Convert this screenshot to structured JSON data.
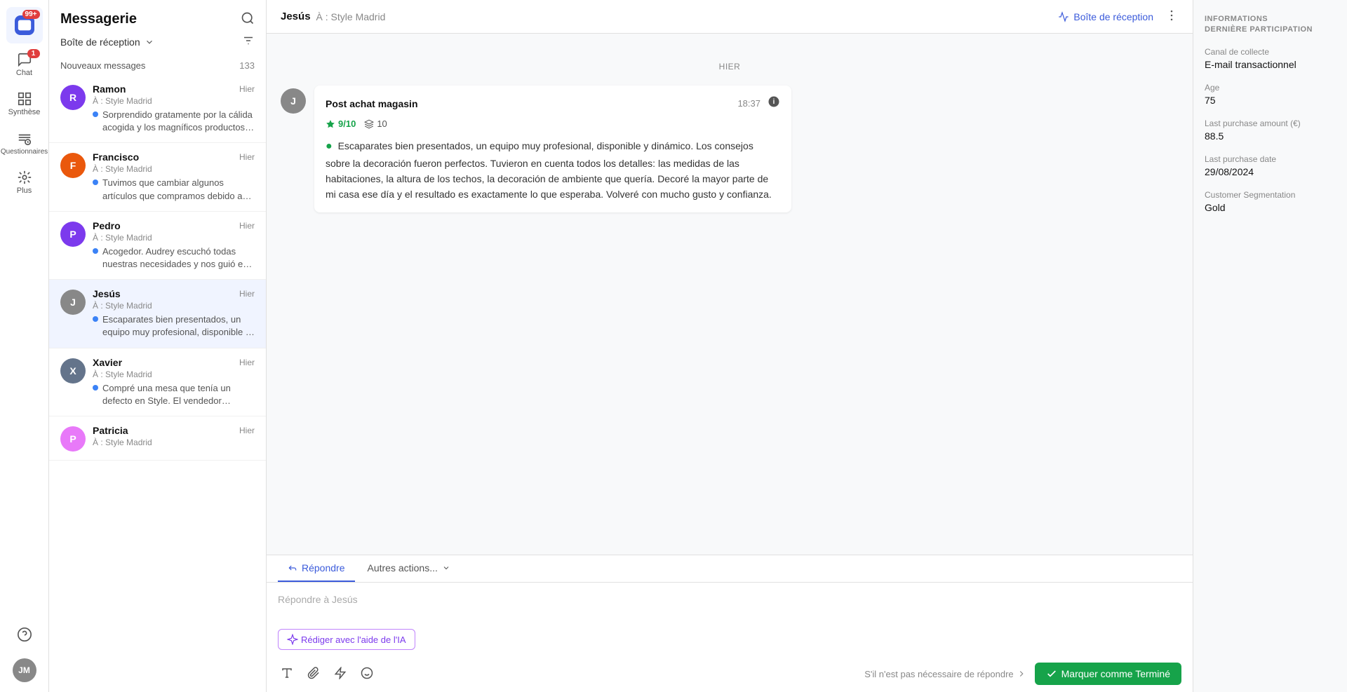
{
  "iconBar": {
    "messagerie": "Messagerie",
    "chat": "Chat",
    "synthese": "Synthèse",
    "questionnaires": "Questionnaires",
    "plus": "Plus",
    "badge99": "99+",
    "badge1": "1",
    "userInitials": "JM"
  },
  "sidebar": {
    "title": "Messagerie",
    "inboxLabel": "Boîte de réception",
    "newMessages": "Nouveaux messages",
    "newCount": "133",
    "messages": [
      {
        "initial": "R",
        "name": "Ramon",
        "destination": "À : Style Madrid",
        "time": "Hier",
        "preview": "Sorprendido gratamente por la cálida acogida y los magníficos productos. Amplia...",
        "color": "#7c3aed"
      },
      {
        "initial": "F",
        "name": "Francisco",
        "destination": "À : Style Madrid",
        "time": "Hier",
        "preview": "Tuvimos que cambiar algunos artículos que compramos debido a que el color no er...",
        "color": "#ea580c"
      },
      {
        "initial": "P",
        "name": "Pedro",
        "destination": "À : Style Madrid",
        "time": "Hier",
        "preview": "Acogedor. Audrey escuchó todas nuestras necesidades y nos guió en nuestra...",
        "color": "#7c3aed"
      },
      {
        "initial": "J",
        "name": "Jesús",
        "destination": "À : Style Madrid",
        "time": "Hier",
        "preview": "Escaparates bien presentados, un equipo muy profesional, disponible y dinámico. Los...",
        "color": "#888",
        "active": true
      },
      {
        "initial": "X",
        "name": "Xavier",
        "destination": "À : Style Madrid",
        "time": "Hier",
        "preview": "Compré una mesa que tenía un defecto en Style. El vendedor accedió a cerrar la...",
        "color": "#64748b"
      },
      {
        "initial": "P",
        "name": "Patricia",
        "destination": "À : Style Madrid",
        "time": "Hier",
        "preview": "",
        "color": "#e879f9"
      }
    ]
  },
  "chat": {
    "senderName": "Jesús",
    "toLabel": "À :",
    "destination": "Style Madrid",
    "inboxLabel": "Boîte de réception",
    "dateDivider": "HIER",
    "message": {
      "avatarInitial": "J",
      "type": "Post achat magasin",
      "time": "18:37",
      "scoreGreen": "9/10",
      "scoreLayers": "10",
      "text": "Escaparates bien presentados, un equipo muy profesional, disponible y dinámico. Los consejos sobre la decoración fueron perfectos. Tuvieron en cuenta todos los detalles: las medidas de las habitaciones, la altura de los techos, la decoración de ambiente que quería. Decoré la mayor parte de mi casa ese día y el resultado es exactamente lo que esperaba. Volveré con mucho gusto y confianza."
    }
  },
  "reply": {
    "repondreLabel": "Répondre",
    "autresActionsLabel": "Autres actions...",
    "placeholder": "Répondre à Jesús",
    "aiButtonLabel": "Rédiger avec l'aide de l'IA",
    "noReplyText": "S'il n'est pas nécessaire de répondre",
    "markDoneLabel": "Marquer comme Terminé"
  },
  "infoPanel": {
    "sectionTitle": "INFORMATIONS\nDERNIÈRE PARTICIPATION",
    "fields": [
      {
        "label": "Canal de collecte",
        "value": "E-mail transactionnel"
      },
      {
        "label": "Age",
        "value": "75"
      },
      {
        "label": "Last purchase amount (€)",
        "value": "88.5"
      },
      {
        "label": "Last purchase date",
        "value": "29/08/2024"
      },
      {
        "label": "Customer Segmentation",
        "value": "Gold"
      }
    ]
  }
}
